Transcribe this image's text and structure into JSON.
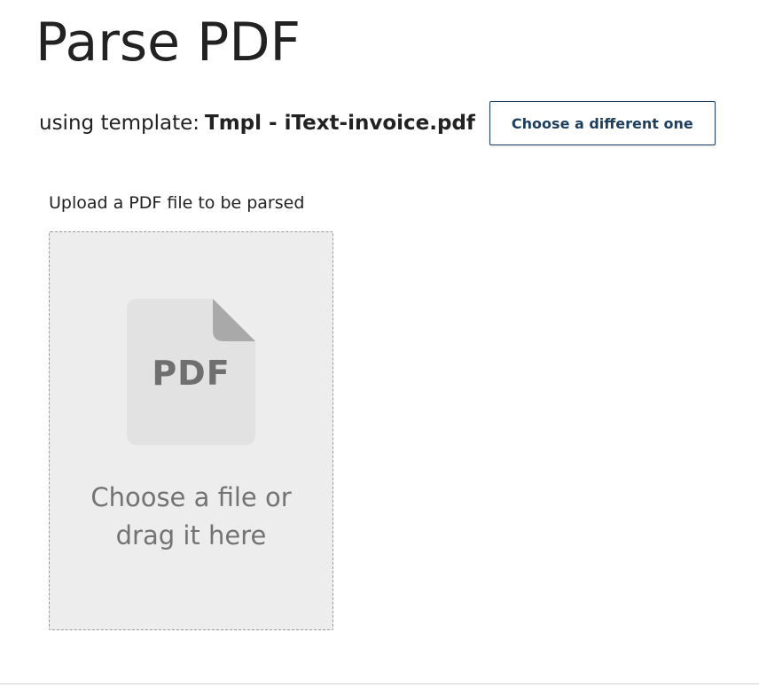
{
  "page": {
    "title": "Parse PDF"
  },
  "template": {
    "prefix": "using template:",
    "name": "Tmpl - iText-invoice.pdf",
    "change_button_label": "Choose a different one"
  },
  "upload": {
    "label": "Upload a PDF file to be parsed",
    "icon": "pdf-file-icon",
    "icon_text": "PDF",
    "dropzone_line1": "Choose a file or",
    "dropzone_line2": "drag it here"
  },
  "colors": {
    "button_accent": "#1d3f5e",
    "dropzone_bg": "#ededed",
    "icon_fill": "#e2e2e2",
    "icon_fold": "#a9a9a9",
    "icon_text": "#6f6f6f"
  }
}
